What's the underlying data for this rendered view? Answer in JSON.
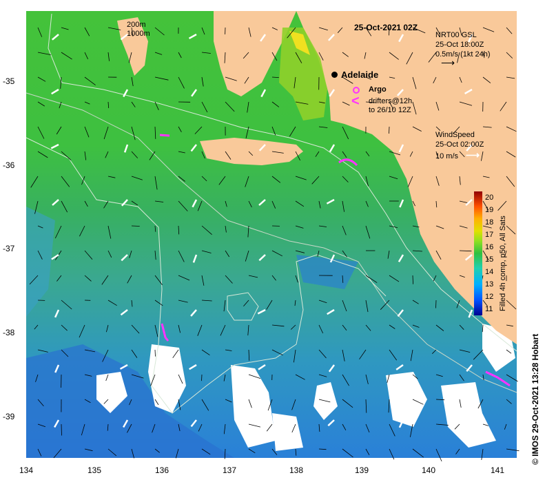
{
  "map": {
    "date_title": "25-Oct-2021 02Z",
    "city": "Adelaide",
    "depth_labels": [
      "200m",
      "1000m"
    ],
    "argo_label": "Argo",
    "drifters_label_1": "drifters@12h",
    "drifters_label_2": "to 26/10 12Z",
    "current_product": "NRT00 GSL",
    "current_time": "25-Oct 18:00Z",
    "current_scale": "0.5m/s (1kt 24h)",
    "wind_title": "WindSpeed",
    "wind_time": "25-Oct 02:00Z",
    "wind_scale": "10 m/s",
    "colorbar_label": "Filled 4h comp, p50, All Sats",
    "colorbar_ticks": [
      "20",
      "19",
      "18",
      "17",
      "16",
      "15",
      "14",
      "13",
      "12",
      "11"
    ],
    "credit": "© IMOS 29-Oct-2021 13:28 Hobart",
    "x_ticks": [
      "134",
      "135",
      "136",
      "137",
      "138",
      "139",
      "140",
      "141"
    ],
    "y_ticks": [
      "-35",
      "-36",
      "-37",
      "-38",
      "-39"
    ],
    "colors": {
      "land": "#f9c99a",
      "sst_16": "#3fbf3f",
      "sst_15": "#2fb060",
      "sst_14": "#3aa8a0",
      "sst_13": "#2a8ad0",
      "cloud": "#ffffff",
      "drifter": "#ff33ff"
    }
  }
}
